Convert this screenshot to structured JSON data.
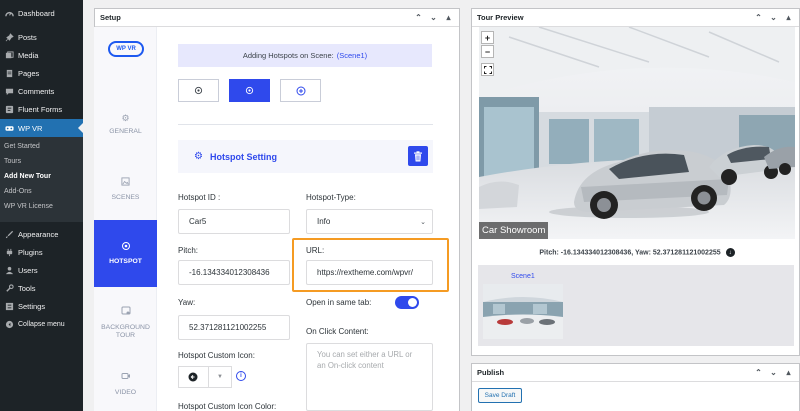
{
  "sidebar": {
    "items": [
      {
        "label": "Dashboard",
        "icon": "dashboard-icon"
      },
      {
        "label": "Posts",
        "icon": "pin-icon"
      },
      {
        "label": "Media",
        "icon": "media-icon"
      },
      {
        "label": "Pages",
        "icon": "pages-icon"
      },
      {
        "label": "Comments",
        "icon": "comments-icon"
      },
      {
        "label": "Fluent Forms",
        "icon": "forms-icon"
      },
      {
        "label": "WP VR",
        "icon": "vr-icon"
      }
    ],
    "submenu": [
      "Get Started",
      "Tours",
      "Add New Tour",
      "Add-Ons",
      "WP VR License"
    ],
    "items2": [
      {
        "label": "Appearance",
        "icon": "brush-icon"
      },
      {
        "label": "Plugins",
        "icon": "plugin-icon"
      },
      {
        "label": "Users",
        "icon": "users-icon"
      },
      {
        "label": "Tools",
        "icon": "wrench-icon"
      },
      {
        "label": "Settings",
        "icon": "settings-icon"
      },
      {
        "label": "Collapse menu",
        "icon": "collapse-icon"
      }
    ]
  },
  "setup": {
    "title": "Setup",
    "logo": "WP VR",
    "tabs": [
      "GENERAL",
      "SCENES",
      "HOTSPOT",
      "BACKGROUND TOUR",
      "VIDEO"
    ],
    "banner_prefix": "Adding Hotspots on Scene:",
    "banner_scene": "(Scene1)",
    "hotspot_setting": "Hotspot Setting",
    "fields": {
      "hotspot_id_label": "Hotspot ID :",
      "hotspot_id_value": "Car5",
      "hotspot_type_label": "Hotspot-Type:",
      "hotspot_type_value": "Info",
      "pitch_label": "Pitch:",
      "pitch_value": "-16.134334012308436",
      "url_label": "URL:",
      "url_value": "https://rextheme.com/wpvr/",
      "yaw_label": "Yaw:",
      "yaw_value": "52.371281121002255",
      "same_tab_label": "Open in same tab:",
      "same_tab_on": true,
      "on_click_label": "On Click Content:",
      "on_click_placeholder": "You can set either a URL or an On-click content",
      "custom_icon_label": "Hotspot Custom Icon:",
      "custom_icon_color_label": "Hotspot Custom Icon Color:"
    }
  },
  "preview": {
    "title": "Tour Preview",
    "scene_title": "Car Showroom",
    "pitch_yaw": "Pitch: -16.134334012308436, Yaw: 52.371281121002255",
    "scene_thumb_label": "Scene1"
  },
  "publish": {
    "title": "Publish",
    "save_draft": "Save Draft"
  },
  "colors": {
    "accent": "#2f49ec",
    "admin_bg": "#1d2327",
    "highlight": "#f59b23"
  }
}
